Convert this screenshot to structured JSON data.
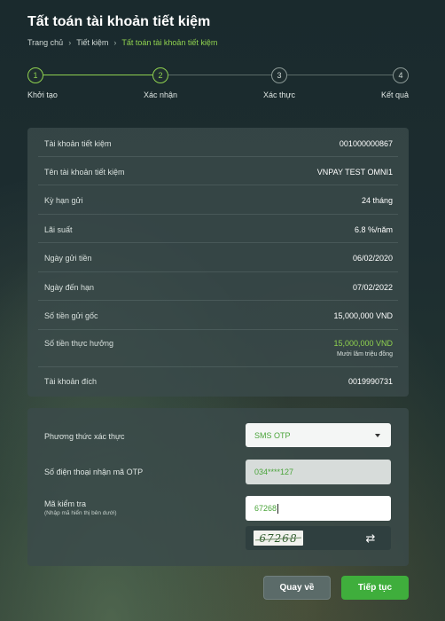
{
  "page": {
    "title": "Tất toán tài khoản tiết kiệm"
  },
  "breadcrumb": {
    "home": "Trang chủ",
    "section": "Tiết kiệm",
    "current": "Tất toán tài khoản tiết kiệm",
    "separator": "›"
  },
  "stepper": {
    "steps": [
      {
        "number": "1",
        "label": "Khởi tạo",
        "status": "done"
      },
      {
        "number": "2",
        "label": "Xác nhận",
        "status": "done"
      },
      {
        "number": "3",
        "label": "Xác thực",
        "status": "pending"
      },
      {
        "number": "4",
        "label": "Kết quả",
        "status": "pending"
      }
    ]
  },
  "details": {
    "rows": [
      {
        "label": "Tài khoản tiết kiệm",
        "value": "001000000867"
      },
      {
        "label": "Tên tài khoản tiết kiệm",
        "value": "VNPAY TEST OMNI1"
      },
      {
        "label": "Kỳ hạn gửi",
        "value": "24 tháng"
      },
      {
        "label": "Lãi suất",
        "value": "6.8 %/năm"
      },
      {
        "label": "Ngày gửi tiền",
        "value": "06/02/2020"
      },
      {
        "label": "Ngày đến hạn",
        "value": "07/02/2022"
      },
      {
        "label": "Số tiền gửi gốc",
        "value": "15,000,000 VND"
      },
      {
        "label": "Số tiền thực hưởng",
        "value": "15,000,000 VND",
        "sub": "Mười lăm triệu đồng"
      },
      {
        "label": "Tài khoản đích",
        "value": "0019990731"
      }
    ]
  },
  "verify": {
    "method_label": "Phương thức xác thực",
    "method_value": "SMS OTP",
    "phone_label": "Số điện thoại nhận mã OTP",
    "phone_value": "034****127",
    "captcha_label": "Mã kiểm tra",
    "captcha_hint": "(Nhập mã hiển thị bên dưới)",
    "captcha_input": "67268",
    "captcha_image_text": "67268"
  },
  "actions": {
    "back_label": "Quay về",
    "next_label": "Tiếp tục"
  },
  "colors": {
    "accent": "#8fd14f",
    "primary_button": "#3fae3c",
    "secondary_button": "#5b6b69",
    "card": "#3a4a4a"
  },
  "icons": {
    "refresh": "refresh-icon",
    "dropdown": "chevron-down-icon"
  }
}
